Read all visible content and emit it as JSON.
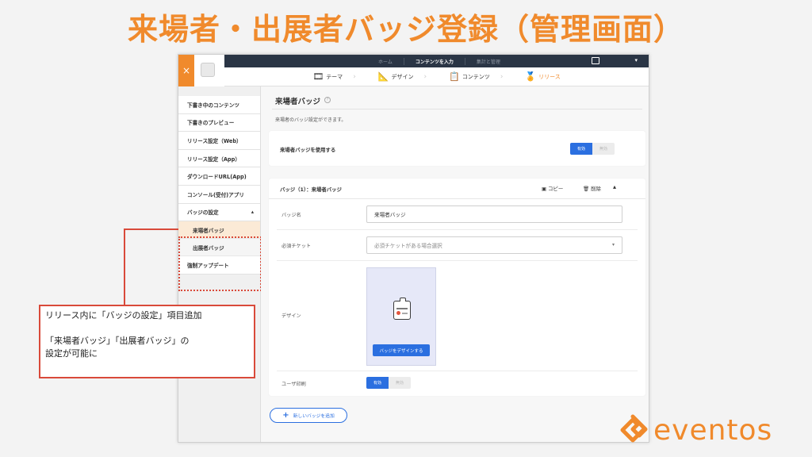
{
  "slide": {
    "title": "来場者・出展者バッジ登録（管理画面）",
    "callout_line1": "リリース内に「バッジの設定」項目追加",
    "callout_line2": "「来場者バッジ」「出展者バッジ」の",
    "callout_line3": "設定が可能に",
    "logo_text": "eventos"
  },
  "app": {
    "close_label": "×",
    "topnav": [
      "ホーム",
      "コンテンツを入力",
      "集計と管理"
    ],
    "topnav_active": "コンテンツを入力",
    "steps": [
      {
        "label": "テーマ",
        "icon": "theme-icon"
      },
      {
        "label": "デザイン",
        "icon": "design-icon"
      },
      {
        "label": "コンテンツ",
        "icon": "content-icon"
      },
      {
        "label": "リリース",
        "icon": "release-icon"
      }
    ],
    "steps_active": "リリース"
  },
  "sidebar": {
    "items": [
      "下書き中のコンテンツ",
      "下書きのプレビュー",
      "リリース設定（Web）",
      "リリース設定（App）",
      "ダウンロードURL(App)",
      "コンソール(受付)アプリ"
    ],
    "group": {
      "label": "バッジの設定",
      "caret": "▴",
      "children": [
        "来場者バッジ",
        "出展者バッジ"
      ],
      "selected": "来場者バッジ"
    },
    "last_item": "強制アップデート"
  },
  "main": {
    "title": "来場者バッジ",
    "help": "?",
    "description": "来場者のバッジ設定ができます。",
    "use_badge": {
      "label": "来場者バッジを使用する",
      "on_label": "有効",
      "off_label": "無効"
    },
    "badge_card": {
      "title": "バッジ（1）：来場者バッジ",
      "copy_label": "コピー",
      "delete_label": "削除",
      "collapse": "▴",
      "name_label": "バッジ名",
      "name_value": "来場者バッジ",
      "ticket_label": "必須チケット",
      "ticket_placeholder": "必須チケットがある場合選択",
      "design_label": "デザイン",
      "design_button": "バッジをデザインする",
      "print_label": "ユーザ印刷",
      "print_on": "有効",
      "print_off": "無効"
    },
    "add_button": "新しいバッジを追加"
  },
  "colors": {
    "accent_orange": "#f08a2c",
    "primary_blue": "#2b6fe0",
    "callout_red": "#d94a3a",
    "topbar": "#2a3545"
  }
}
